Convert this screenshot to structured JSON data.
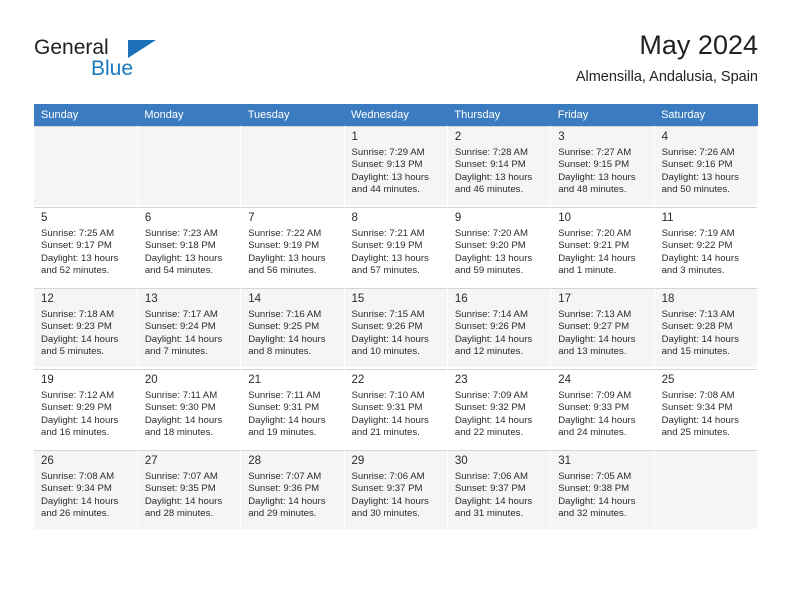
{
  "logo": {
    "word_top": "General",
    "word_bottom": "Blue",
    "triangle_icon": "blue-triangle-icon",
    "accent_color": "#1878be"
  },
  "header": {
    "title": "May 2024",
    "subtitle": "Almensilla, Andalusia, Spain"
  },
  "calendar": {
    "header_bg": "#3b7cc0",
    "weekday_headers": [
      "Sunday",
      "Monday",
      "Tuesday",
      "Wednesday",
      "Thursday",
      "Friday",
      "Saturday"
    ],
    "weeks": [
      [
        {
          "day": ""
        },
        {
          "day": ""
        },
        {
          "day": ""
        },
        {
          "day": "1",
          "sunrise": "Sunrise: 7:29 AM",
          "sunset": "Sunset: 9:13 PM",
          "daylight_1": "Daylight: 13 hours",
          "daylight_2": "and 44 minutes."
        },
        {
          "day": "2",
          "sunrise": "Sunrise: 7:28 AM",
          "sunset": "Sunset: 9:14 PM",
          "daylight_1": "Daylight: 13 hours",
          "daylight_2": "and 46 minutes."
        },
        {
          "day": "3",
          "sunrise": "Sunrise: 7:27 AM",
          "sunset": "Sunset: 9:15 PM",
          "daylight_1": "Daylight: 13 hours",
          "daylight_2": "and 48 minutes."
        },
        {
          "day": "4",
          "sunrise": "Sunrise: 7:26 AM",
          "sunset": "Sunset: 9:16 PM",
          "daylight_1": "Daylight: 13 hours",
          "daylight_2": "and 50 minutes."
        }
      ],
      [
        {
          "day": "5",
          "sunrise": "Sunrise: 7:25 AM",
          "sunset": "Sunset: 9:17 PM",
          "daylight_1": "Daylight: 13 hours",
          "daylight_2": "and 52 minutes."
        },
        {
          "day": "6",
          "sunrise": "Sunrise: 7:23 AM",
          "sunset": "Sunset: 9:18 PM",
          "daylight_1": "Daylight: 13 hours",
          "daylight_2": "and 54 minutes."
        },
        {
          "day": "7",
          "sunrise": "Sunrise: 7:22 AM",
          "sunset": "Sunset: 9:19 PM",
          "daylight_1": "Daylight: 13 hours",
          "daylight_2": "and 56 minutes."
        },
        {
          "day": "8",
          "sunrise": "Sunrise: 7:21 AM",
          "sunset": "Sunset: 9:19 PM",
          "daylight_1": "Daylight: 13 hours",
          "daylight_2": "and 57 minutes."
        },
        {
          "day": "9",
          "sunrise": "Sunrise: 7:20 AM",
          "sunset": "Sunset: 9:20 PM",
          "daylight_1": "Daylight: 13 hours",
          "daylight_2": "and 59 minutes."
        },
        {
          "day": "10",
          "sunrise": "Sunrise: 7:20 AM",
          "sunset": "Sunset: 9:21 PM",
          "daylight_1": "Daylight: 14 hours",
          "daylight_2": "and 1 minute."
        },
        {
          "day": "11",
          "sunrise": "Sunrise: 7:19 AM",
          "sunset": "Sunset: 9:22 PM",
          "daylight_1": "Daylight: 14 hours",
          "daylight_2": "and 3 minutes."
        }
      ],
      [
        {
          "day": "12",
          "sunrise": "Sunrise: 7:18 AM",
          "sunset": "Sunset: 9:23 PM",
          "daylight_1": "Daylight: 14 hours",
          "daylight_2": "and 5 minutes."
        },
        {
          "day": "13",
          "sunrise": "Sunrise: 7:17 AM",
          "sunset": "Sunset: 9:24 PM",
          "daylight_1": "Daylight: 14 hours",
          "daylight_2": "and 7 minutes."
        },
        {
          "day": "14",
          "sunrise": "Sunrise: 7:16 AM",
          "sunset": "Sunset: 9:25 PM",
          "daylight_1": "Daylight: 14 hours",
          "daylight_2": "and 8 minutes."
        },
        {
          "day": "15",
          "sunrise": "Sunrise: 7:15 AM",
          "sunset": "Sunset: 9:26 PM",
          "daylight_1": "Daylight: 14 hours",
          "daylight_2": "and 10 minutes."
        },
        {
          "day": "16",
          "sunrise": "Sunrise: 7:14 AM",
          "sunset": "Sunset: 9:26 PM",
          "daylight_1": "Daylight: 14 hours",
          "daylight_2": "and 12 minutes."
        },
        {
          "day": "17",
          "sunrise": "Sunrise: 7:13 AM",
          "sunset": "Sunset: 9:27 PM",
          "daylight_1": "Daylight: 14 hours",
          "daylight_2": "and 13 minutes."
        },
        {
          "day": "18",
          "sunrise": "Sunrise: 7:13 AM",
          "sunset": "Sunset: 9:28 PM",
          "daylight_1": "Daylight: 14 hours",
          "daylight_2": "and 15 minutes."
        }
      ],
      [
        {
          "day": "19",
          "sunrise": "Sunrise: 7:12 AM",
          "sunset": "Sunset: 9:29 PM",
          "daylight_1": "Daylight: 14 hours",
          "daylight_2": "and 16 minutes."
        },
        {
          "day": "20",
          "sunrise": "Sunrise: 7:11 AM",
          "sunset": "Sunset: 9:30 PM",
          "daylight_1": "Daylight: 14 hours",
          "daylight_2": "and 18 minutes."
        },
        {
          "day": "21",
          "sunrise": "Sunrise: 7:11 AM",
          "sunset": "Sunset: 9:31 PM",
          "daylight_1": "Daylight: 14 hours",
          "daylight_2": "and 19 minutes."
        },
        {
          "day": "22",
          "sunrise": "Sunrise: 7:10 AM",
          "sunset": "Sunset: 9:31 PM",
          "daylight_1": "Daylight: 14 hours",
          "daylight_2": "and 21 minutes."
        },
        {
          "day": "23",
          "sunrise": "Sunrise: 7:09 AM",
          "sunset": "Sunset: 9:32 PM",
          "daylight_1": "Daylight: 14 hours",
          "daylight_2": "and 22 minutes."
        },
        {
          "day": "24",
          "sunrise": "Sunrise: 7:09 AM",
          "sunset": "Sunset: 9:33 PM",
          "daylight_1": "Daylight: 14 hours",
          "daylight_2": "and 24 minutes."
        },
        {
          "day": "25",
          "sunrise": "Sunrise: 7:08 AM",
          "sunset": "Sunset: 9:34 PM",
          "daylight_1": "Daylight: 14 hours",
          "daylight_2": "and 25 minutes."
        }
      ],
      [
        {
          "day": "26",
          "sunrise": "Sunrise: 7:08 AM",
          "sunset": "Sunset: 9:34 PM",
          "daylight_1": "Daylight: 14 hours",
          "daylight_2": "and 26 minutes."
        },
        {
          "day": "27",
          "sunrise": "Sunrise: 7:07 AM",
          "sunset": "Sunset: 9:35 PM",
          "daylight_1": "Daylight: 14 hours",
          "daylight_2": "and 28 minutes."
        },
        {
          "day": "28",
          "sunrise": "Sunrise: 7:07 AM",
          "sunset": "Sunset: 9:36 PM",
          "daylight_1": "Daylight: 14 hours",
          "daylight_2": "and 29 minutes."
        },
        {
          "day": "29",
          "sunrise": "Sunrise: 7:06 AM",
          "sunset": "Sunset: 9:37 PM",
          "daylight_1": "Daylight: 14 hours",
          "daylight_2": "and 30 minutes."
        },
        {
          "day": "30",
          "sunrise": "Sunrise: 7:06 AM",
          "sunset": "Sunset: 9:37 PM",
          "daylight_1": "Daylight: 14 hours",
          "daylight_2": "and 31 minutes."
        },
        {
          "day": "31",
          "sunrise": "Sunrise: 7:05 AM",
          "sunset": "Sunset: 9:38 PM",
          "daylight_1": "Daylight: 14 hours",
          "daylight_2": "and 32 minutes."
        },
        {
          "day": ""
        }
      ]
    ]
  }
}
